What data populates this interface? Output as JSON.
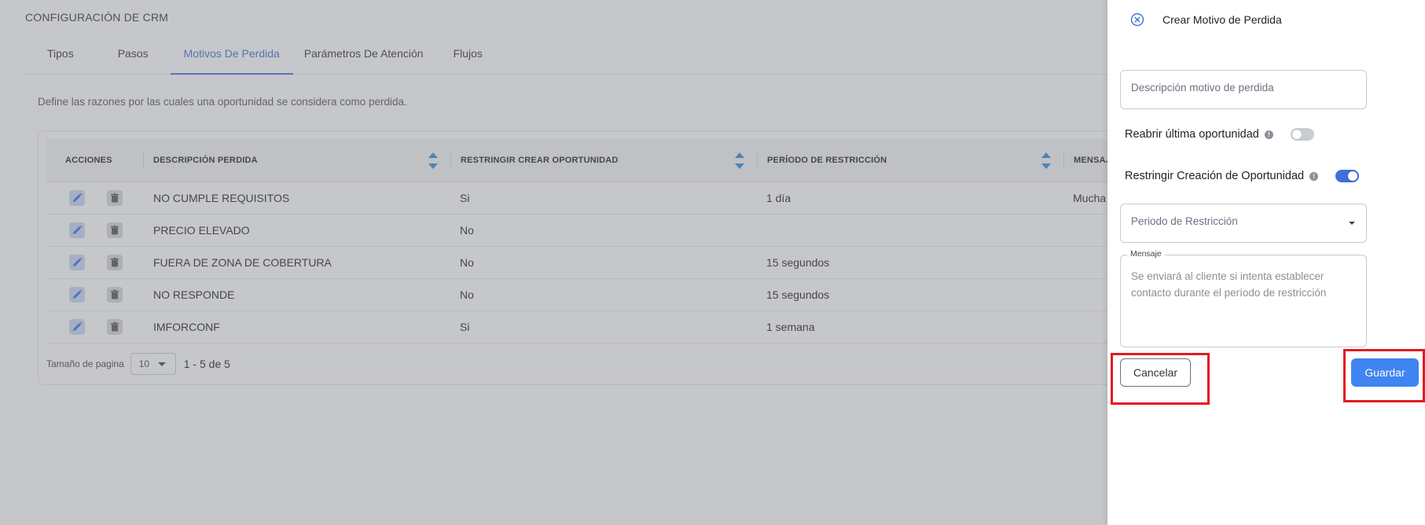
{
  "page": {
    "title": "CONFIGURACIÓN DE CRM",
    "tabs": [
      {
        "label": "Tipos"
      },
      {
        "label": "Pasos"
      },
      {
        "label": "Motivos De Perdida"
      },
      {
        "label": "Parámetros De Atención"
      },
      {
        "label": "Flujos"
      }
    ],
    "active_tab": "Motivos De Perdida",
    "description": "Define las razones por las cuales una oportunidad se considera como perdida."
  },
  "table": {
    "headers": {
      "actions": "ACCIONES",
      "description": "DESCRIPCIÓN PERDIDA",
      "restrict": "RESTRINGIR CREAR OPORTUNIDAD",
      "period": "PERÍODO DE RESTRICCIÓN",
      "message": "MENSAJ"
    },
    "rows": [
      {
        "description": "NO CUMPLE REQUISITOS",
        "restrict": "Si",
        "period": "1 día",
        "message": "Mucha"
      },
      {
        "description": "PRECIO ELEVADO",
        "restrict": "No",
        "period": "",
        "message": ""
      },
      {
        "description": "FUERA DE ZONA DE COBERTURA",
        "restrict": "No",
        "period": "15 segundos",
        "message": ""
      },
      {
        "description": "NO RESPONDE",
        "restrict": "No",
        "period": "15 segundos",
        "message": ""
      },
      {
        "description": "IMFORCONF",
        "restrict": "Si",
        "period": "1 semana",
        "message": ""
      }
    ],
    "row_icons": {
      "edit": "pencil-icon",
      "delete": "trash-icon"
    }
  },
  "pagination": {
    "label": "Tamaño de pagina",
    "page_size": "10",
    "range": "1 - 5 de 5"
  },
  "drawer": {
    "title": "Crear Motivo de Perdida",
    "close_icon": "close-circle-icon",
    "description_placeholder": "Descripción motivo de perdida",
    "reopen_label": "Reabrir última oportunidad",
    "reopen_on": false,
    "restrict_label": "Restringir Creación de Oportunidad",
    "restrict_on": true,
    "period_placeholder": "Periodo de Restricción",
    "message_label": "Mensaje",
    "message_placeholder": "Se enviará al cliente si intenta establecer contacto durante el período de restricción",
    "cancel_label": "Cancelar",
    "save_label": "Guardar"
  },
  "colors": {
    "accent": "#3f6fd8",
    "save_button": "#3f84f0",
    "highlight": "#e11b22",
    "overlay": "rgba(120,122,128,0.42)"
  }
}
